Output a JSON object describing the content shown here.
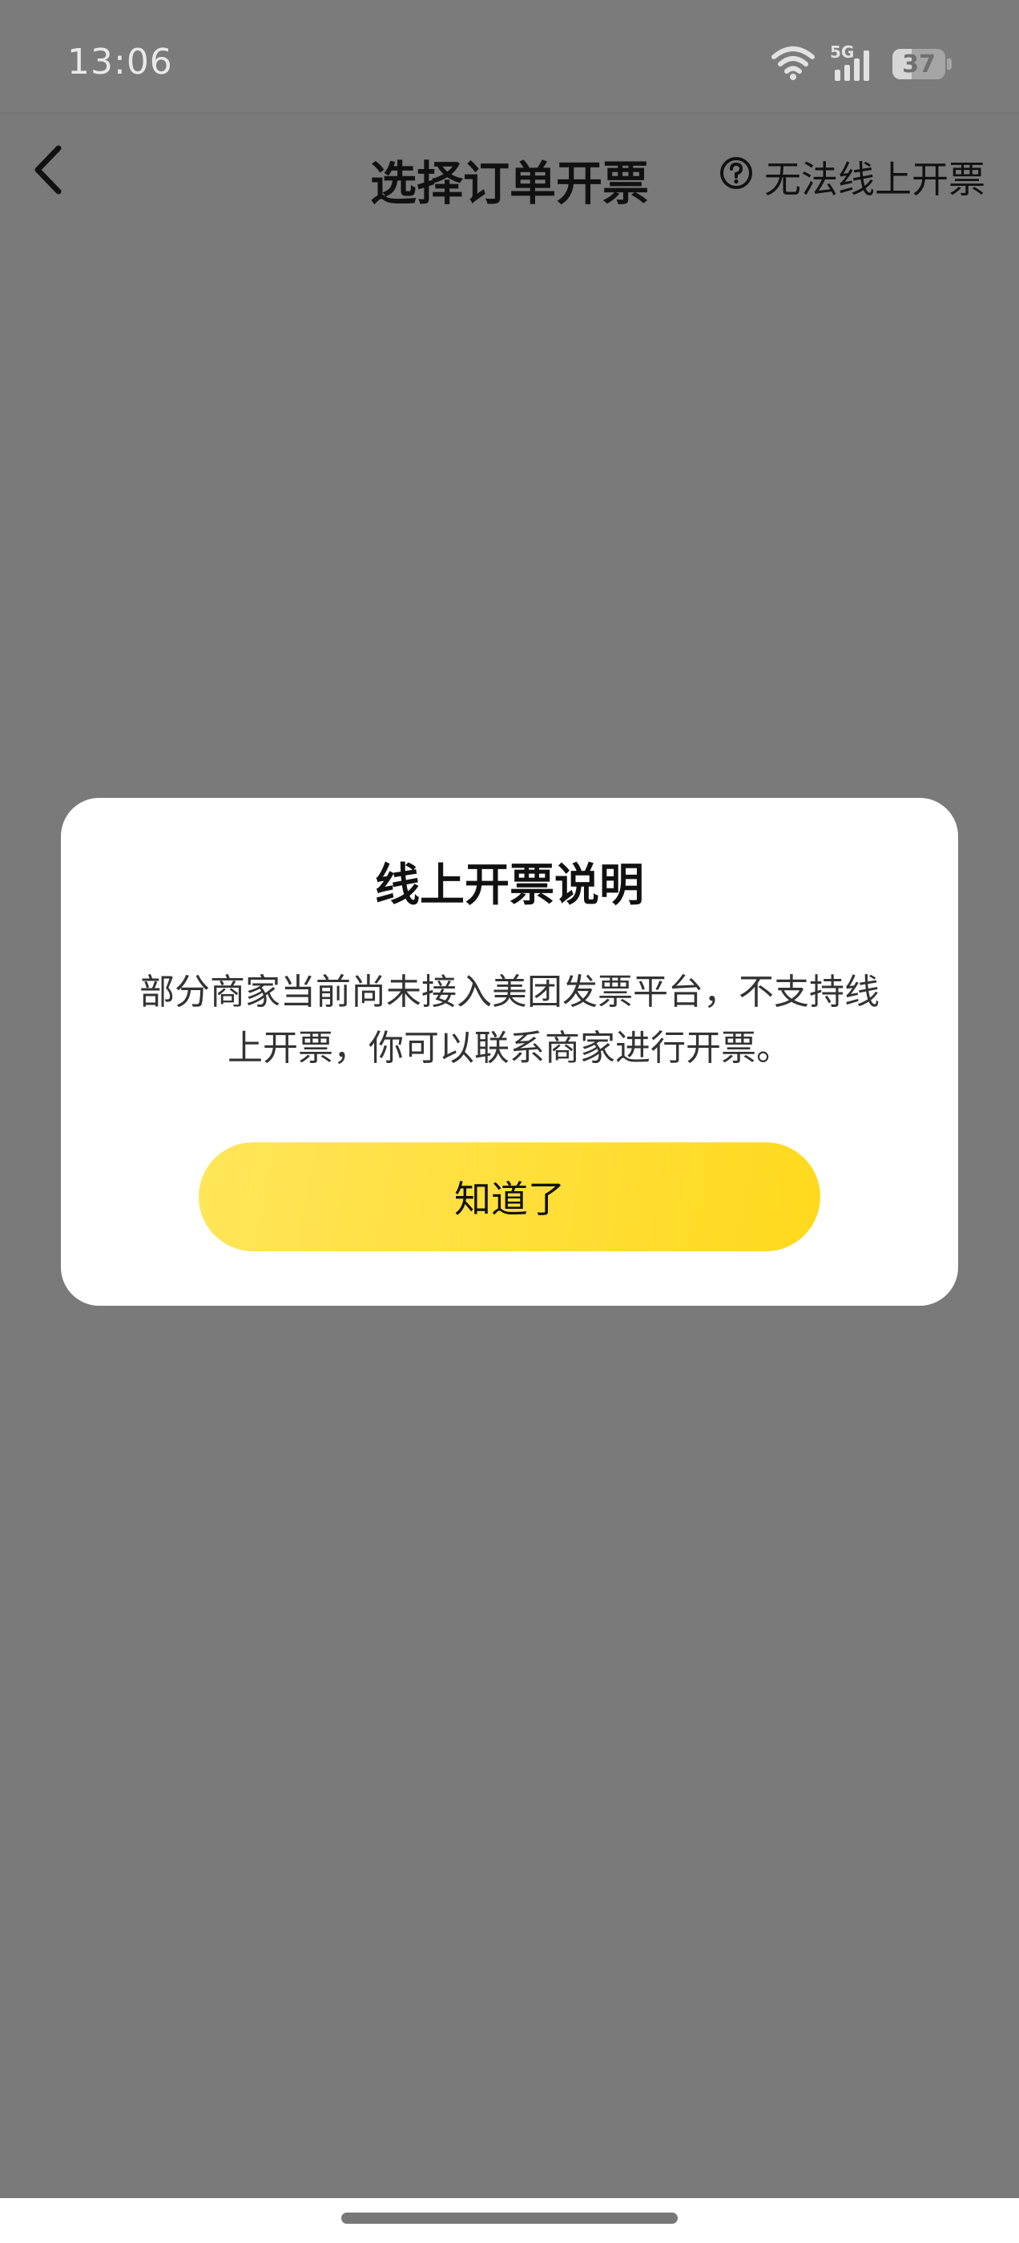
{
  "status_bar": {
    "time": "13:06",
    "network": "5G",
    "battery": "37",
    "battery_level": 0.37
  },
  "header": {
    "back_icon": "chevron-left-icon",
    "title": "选择订单开票",
    "help_icon": "question-circle-icon",
    "help_label": "无法线上开票"
  },
  "dialog": {
    "title": "线上开票说明",
    "message": "部分商家当前尚未接入美团发票平台，不支持线上开票，你可以联系商家进行开票。",
    "confirm_label": "知道了"
  },
  "colors": {
    "overlay": "#7a7a7a",
    "button_start": "#ffe55a",
    "button_end": "#ffd91c"
  }
}
